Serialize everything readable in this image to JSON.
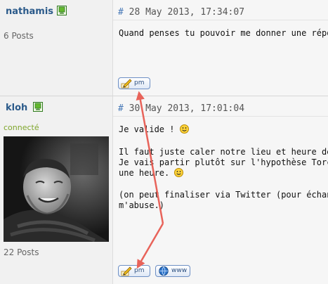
{
  "posts": [
    {
      "author": "nathamis",
      "status": "",
      "posts_count": "6 Posts",
      "date_hash": "#",
      "date": "28 May 2013, 17:34:07",
      "body_line1": "Quand penses tu pouvoir me donner une répon",
      "pm_label": "pm"
    },
    {
      "author": "kloh",
      "status": "connecté",
      "posts_count": "22 Posts",
      "date_hash": "#",
      "date": "30 May 2013, 17:01:04",
      "body_line1": "Je valide ! ",
      "body_line2": "Il faut juste caler notre lieu et heure de rencon",
      "body_line3": "Je vais partir plutôt sur l'hypothèse Torcy car g",
      "body_line4": "une heure. ",
      "body_line5": "(on peut finaliser via Twitter (pour échanger n",
      "body_line6": "m'abuse.)",
      "pm_label": "pm",
      "www_label": "www"
    }
  ],
  "colors": {
    "username": "#2b5a8a",
    "online_status": "#7fa62c",
    "annotation_arrow": "#e8635a",
    "button_border": "#6d8fc4"
  },
  "icons": {
    "online": "online-status-icon",
    "pm": "pencil-message-icon",
    "www": "globe-icon",
    "smiley": "smiley-icon"
  }
}
